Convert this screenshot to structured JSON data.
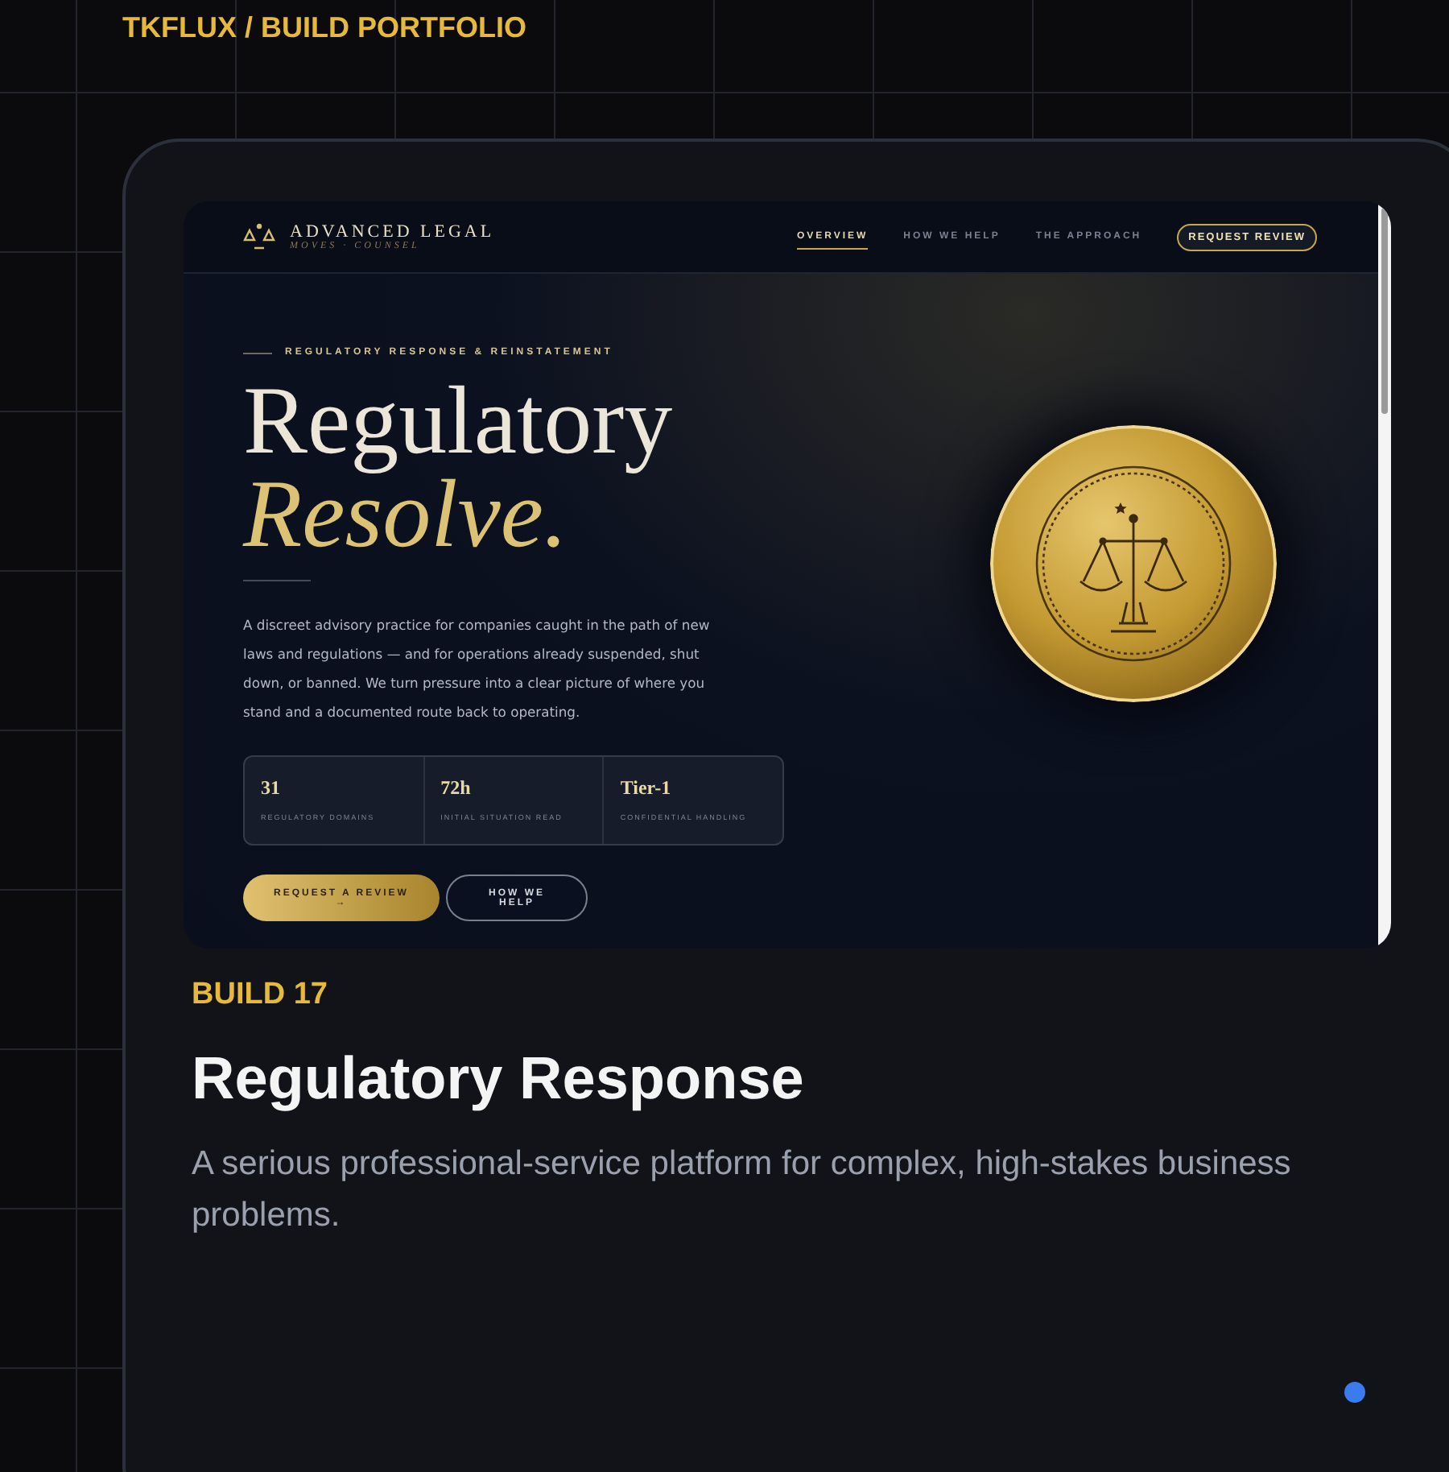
{
  "header": {
    "breadcrumb": "TKFLUX / BUILD PORTFOLIO"
  },
  "preview": {
    "brand": "ADVANCED LEGAL",
    "tagline": "MOVES · COUNSEL",
    "nav": [
      {
        "label": "OVERVIEW",
        "selected": true
      },
      {
        "label": "HOW WE HELP",
        "selected": false
      },
      {
        "label": "THE APPROACH",
        "selected": false
      }
    ],
    "nav_button": "REQUEST REVIEW",
    "eyebrow": "REGULATORY RESPONSE & REINSTATEMENT",
    "headline_line1": "Regulatory",
    "headline_line2": "Resolve.",
    "description": "A discreet advisory practice for companies caught in the path of new laws and regulations — and for operations already suspended, shut down, or banned. We turn pressure into a clear picture of where you stand and a documented route back to operating.",
    "stats": [
      {
        "value": "31",
        "label": "REGULATORY DOMAINS"
      },
      {
        "value": "72h",
        "label": "INITIAL SITUATION READ"
      },
      {
        "value": "Tier-1",
        "label": "CONFIDENTIAL HANDLING"
      }
    ],
    "buttons": [
      {
        "label": "REQUEST A REVIEW →",
        "kind": "primary"
      },
      {
        "label": "HOW WE HELP",
        "kind": "outline"
      }
    ]
  },
  "card": {
    "build_label": "BUILD 17",
    "title": "Regulatory Response",
    "description": "A serious professional-service platform for complex, high-stakes business problems."
  }
}
